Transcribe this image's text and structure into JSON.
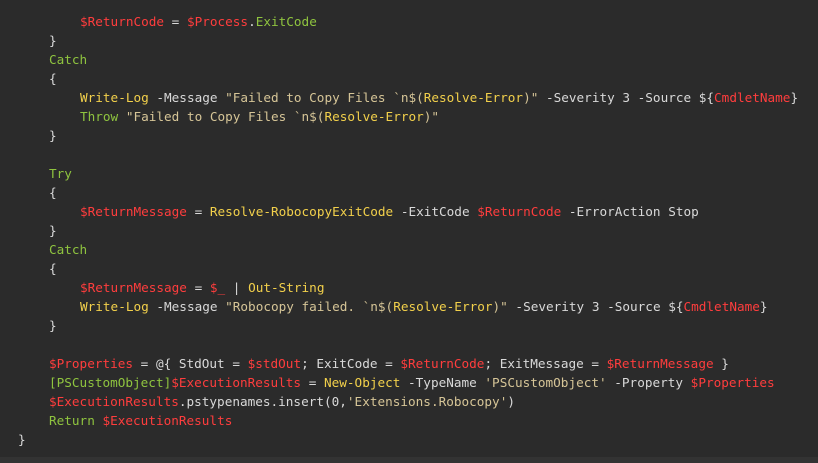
{
  "theme": {
    "background": "#2b2b2b",
    "default_text": "#d9d9d9",
    "variable": "#ff3d3d",
    "keyword": "#8fc43f",
    "command": "#f2d04b",
    "string": "#d6c597"
  },
  "code_lines": [
    {
      "indent": 16,
      "tokens": [
        [
          "var",
          "$"
        ],
        [
          "var",
          "ReturnCode"
        ],
        [
          "default",
          " = "
        ],
        [
          "var",
          "$"
        ],
        [
          "var",
          "Process"
        ],
        [
          "default",
          "."
        ],
        [
          "kw",
          "ExitCode"
        ]
      ]
    },
    {
      "indent": 8,
      "tokens": [
        [
          "default",
          "}"
        ]
      ]
    },
    {
      "indent": 8,
      "tokens": [
        [
          "kw",
          "Catch"
        ]
      ]
    },
    {
      "indent": 8,
      "tokens": [
        [
          "default",
          "{"
        ]
      ]
    },
    {
      "indent": 16,
      "tokens": [
        [
          "cmd",
          "Write-Log"
        ],
        [
          "param",
          " -Message "
        ],
        [
          "str",
          "\"Failed to Copy Files `n$("
        ],
        [
          "cmd",
          "Resolve-Error"
        ],
        [
          "str",
          ")\""
        ],
        [
          "param",
          " -Severity "
        ],
        [
          "num",
          "3"
        ],
        [
          "param",
          " -Source "
        ],
        [
          "default",
          "${"
        ],
        [
          "var",
          "CmdletName"
        ],
        [
          "default",
          "}"
        ]
      ]
    },
    {
      "indent": 16,
      "tokens": [
        [
          "kw",
          "Throw"
        ],
        [
          "default",
          " "
        ],
        [
          "str",
          "\"Failed to Copy Files `n$("
        ],
        [
          "cmd",
          "Resolve-Error"
        ],
        [
          "str",
          ")\""
        ]
      ]
    },
    {
      "indent": 8,
      "tokens": [
        [
          "default",
          "}"
        ]
      ]
    },
    {
      "indent": 0,
      "tokens": []
    },
    {
      "indent": 8,
      "tokens": [
        [
          "kw",
          "Try"
        ]
      ]
    },
    {
      "indent": 8,
      "tokens": [
        [
          "default",
          "{"
        ]
      ]
    },
    {
      "indent": 16,
      "tokens": [
        [
          "var",
          "$"
        ],
        [
          "var",
          "ReturnMessage"
        ],
        [
          "default",
          " = "
        ],
        [
          "cmd",
          "Resolve-RobocopyExitCode"
        ],
        [
          "param",
          " -ExitCode "
        ],
        [
          "var",
          "$"
        ],
        [
          "var",
          "ReturnCode"
        ],
        [
          "param",
          " -ErrorAction "
        ],
        [
          "default",
          "Stop"
        ]
      ]
    },
    {
      "indent": 8,
      "tokens": [
        [
          "default",
          "}"
        ]
      ]
    },
    {
      "indent": 8,
      "tokens": [
        [
          "kw",
          "Catch"
        ]
      ]
    },
    {
      "indent": 8,
      "tokens": [
        [
          "default",
          "{"
        ]
      ]
    },
    {
      "indent": 16,
      "tokens": [
        [
          "var",
          "$"
        ],
        [
          "var",
          "ReturnMessage"
        ],
        [
          "default",
          " = "
        ],
        [
          "var",
          "$_"
        ],
        [
          "default",
          " | "
        ],
        [
          "cmd",
          "Out-String"
        ]
      ]
    },
    {
      "indent": 16,
      "tokens": [
        [
          "cmd",
          "Write-Log"
        ],
        [
          "param",
          " -Message "
        ],
        [
          "str",
          "\"Robocopy failed. `n$("
        ],
        [
          "cmd",
          "Resolve-Error"
        ],
        [
          "str",
          ")\""
        ],
        [
          "param",
          " -Severity "
        ],
        [
          "num",
          "3"
        ],
        [
          "param",
          " -Source "
        ],
        [
          "default",
          "${"
        ],
        [
          "var",
          "CmdletName"
        ],
        [
          "default",
          "}"
        ]
      ]
    },
    {
      "indent": 8,
      "tokens": [
        [
          "default",
          "}"
        ]
      ]
    },
    {
      "indent": 0,
      "tokens": []
    },
    {
      "indent": 8,
      "tokens": [
        [
          "var",
          "$"
        ],
        [
          "var",
          "Properties"
        ],
        [
          "default",
          " = @{ StdOut = "
        ],
        [
          "var",
          "$"
        ],
        [
          "var",
          "stdOut"
        ],
        [
          "default",
          "; ExitCode = "
        ],
        [
          "var",
          "$"
        ],
        [
          "var",
          "ReturnCode"
        ],
        [
          "default",
          "; ExitMessage = "
        ],
        [
          "var",
          "$"
        ],
        [
          "var",
          "ReturnMessage"
        ],
        [
          "default",
          " }"
        ]
      ]
    },
    {
      "indent": 8,
      "tokens": [
        [
          "type",
          "[PSCustomObject]"
        ],
        [
          "var",
          "$"
        ],
        [
          "var",
          "ExecutionResults"
        ],
        [
          "default",
          " = "
        ],
        [
          "cmd",
          "New-Object"
        ],
        [
          "param",
          " -TypeName "
        ],
        [
          "str",
          "'PSCustomObject'"
        ],
        [
          "param",
          " -Property "
        ],
        [
          "var",
          "$"
        ],
        [
          "var",
          "Properties"
        ]
      ]
    },
    {
      "indent": 8,
      "tokens": [
        [
          "var",
          "$"
        ],
        [
          "var",
          "ExecutionResults"
        ],
        [
          "default",
          ".pstypenames.insert(0,"
        ],
        [
          "str",
          "'Extensions.Robocopy'"
        ],
        [
          "default",
          ")"
        ]
      ]
    },
    {
      "indent": 8,
      "tokens": [
        [
          "kw",
          "Return"
        ],
        [
          "default",
          " "
        ],
        [
          "var",
          "$"
        ],
        [
          "var",
          "ExecutionResults"
        ]
      ]
    },
    {
      "indent": 4,
      "tokens": [
        [
          "default",
          "}"
        ]
      ]
    }
  ]
}
